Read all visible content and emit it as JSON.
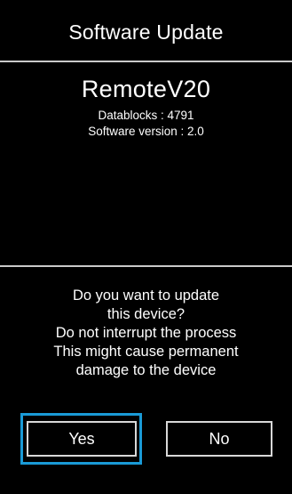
{
  "header": {
    "title": "Software Update"
  },
  "device": {
    "name": "RemoteV20",
    "datablocks_text": "Datablocks :  4791",
    "version_text": "Software version :  2.0"
  },
  "prompt": {
    "lines": [
      "Do you want to update",
      "this device?",
      "Do not interrupt the process",
      "This might cause permanent",
      "damage to the device"
    ]
  },
  "buttons": {
    "yes_label": "Yes",
    "no_label": "No",
    "focused": "Yes"
  },
  "colors": {
    "background": "#000000",
    "text": "#ffffff",
    "divider": "#c9c9c9",
    "focus": "#1a9ad6"
  }
}
